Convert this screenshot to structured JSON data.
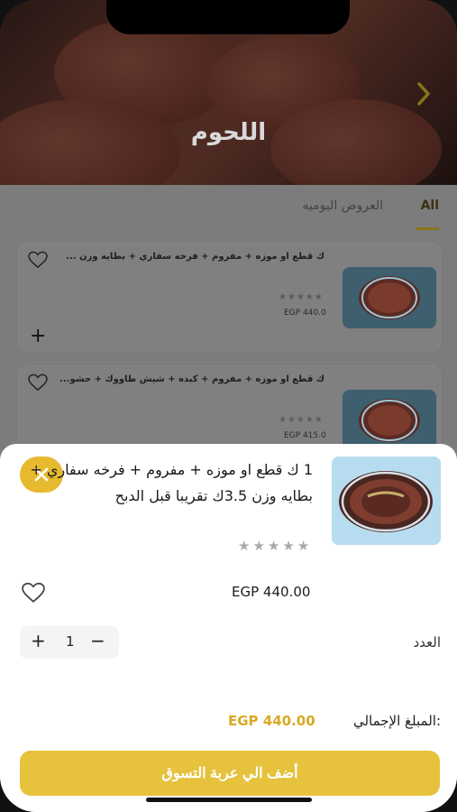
{
  "header": {
    "title": "اللحوم"
  },
  "tabs": [
    {
      "label": "All",
      "active": true
    },
    {
      "label": "العروض اليوميه",
      "active": false
    }
  ],
  "products": [
    {
      "title": "ك قطع او موزه + مفروم + فرخه سفاري + بطايه وزن ...",
      "stars": "★★★★★",
      "price": "EGP 440.0"
    },
    {
      "title": "ك قطع او موزه + مفروم + كبده + شيش طاووك + حشو...",
      "stars": "★★★★★",
      "price": "EGP 415.0"
    }
  ],
  "sheet": {
    "title": "1 ك قطع او موزه + مفروم + فرخه سفاري + بطايه وزن 3.5ك تقريبا قبل الدبح",
    "stars": "★★★★★",
    "price": "EGP 440.00",
    "quantity_label": "العدد",
    "quantity": "1",
    "plus_symbol": "+",
    "minus_symbol": "−",
    "total_label": "المبلغ الإجمالي:",
    "total_value": "EGP 440.00",
    "add_to_cart_label": "أضف الي عربة التسوق"
  },
  "colors": {
    "accent": "#e6c23d",
    "close_button": "#e6b92e",
    "total_value": "#d9a924"
  },
  "icons": {
    "back": "chevron-right-icon",
    "favorite": "heart-icon",
    "close": "close-icon",
    "add": "plus-icon"
  }
}
